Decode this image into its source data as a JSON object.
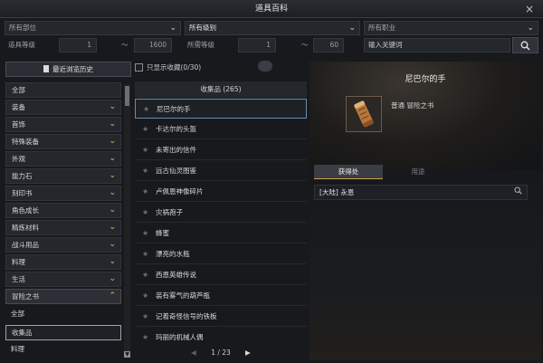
{
  "window": {
    "title": "道具百科",
    "close": "×"
  },
  "filters": {
    "part": "所有部位",
    "grade": "所有级别",
    "job": "所有职业",
    "item_level_label": "道具等级",
    "item_level_min": "1",
    "item_level_max": "1600",
    "tilde": "～",
    "req_level_label": "所需等级",
    "req_level_min": "1",
    "req_level_max": "60",
    "keyword_placeholder": "输入关键词"
  },
  "left": {
    "history_button": "最近浏览历史",
    "categories": [
      {
        "label": "全部",
        "chevron": ""
      },
      {
        "label": "装备",
        "chevron": "⌄"
      },
      {
        "label": "首饰",
        "chevron": "⌄"
      },
      {
        "label": "特殊装备",
        "chevron": "⌄"
      },
      {
        "label": "外观",
        "chevron": "⌄"
      },
      {
        "label": "能力石",
        "chevron": "⌄"
      },
      {
        "label": "刻印书",
        "chevron": "⌄"
      },
      {
        "label": "角色成长",
        "chevron": "⌄"
      },
      {
        "label": "精炼材料",
        "chevron": "⌄"
      },
      {
        "label": "战斗用品",
        "chevron": "⌄"
      },
      {
        "label": "料理",
        "chevron": "⌄"
      },
      {
        "label": "生活",
        "chevron": "⌄"
      },
      {
        "label": "冒险之书",
        "chevron": "⌃"
      }
    ],
    "subitems": [
      "全部",
      "收集品",
      "料理"
    ]
  },
  "middle": {
    "favorites_only": "只显示收藏(0/30)",
    "column_header": "收集品 (265)",
    "items": [
      "尼巴尔的手",
      "卡达尔的头盔",
      "未寄出的信件",
      "远古仙灵图鉴",
      "卢佩恩神像碎片",
      "灾祸孢子",
      "蜂蜜",
      "漂亮的水瓶",
      "西恩英雄传说",
      "装有雾气的葫芦瓶",
      "记着奇怪信号的铁板",
      "玛丽的机械人偶"
    ],
    "pager": "1 / 23",
    "prev": "◀",
    "next": "▶"
  },
  "right": {
    "item_name": "尼巴尔的手",
    "item_type": "普通 冒险之书",
    "tabs": [
      "获得处",
      "用途"
    ],
    "source": "[大陆] 永恩"
  },
  "colors": {
    "accent": "#c9a24c",
    "selected_border": "#6a8aa8"
  }
}
